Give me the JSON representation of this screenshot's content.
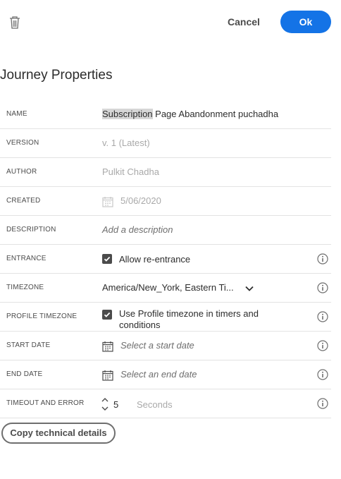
{
  "header": {
    "cancel_label": "Cancel",
    "ok_label": "Ok"
  },
  "page_title": "Journey Properties",
  "properties": {
    "name": {
      "label": "NAME",
      "value_highlight": "Subscription",
      "value_rest": " Page Abandonment puchadha"
    },
    "version": {
      "label": "VERSION",
      "value": "v. 1 (Latest)"
    },
    "author": {
      "label": "AUTHOR",
      "value": "Pulkit Chadha"
    },
    "created": {
      "label": "CREATED",
      "value": "5/06/2020"
    },
    "description": {
      "label": "DESCRIPTION",
      "placeholder": "Add a description"
    },
    "entrance": {
      "label": "ENTRANCE",
      "checkbox_label": "Allow re-entrance",
      "checked": true
    },
    "timezone": {
      "label": "TIMEZONE",
      "value": "America/New_York, Eastern Ti..."
    },
    "profile_timezone": {
      "label": "PROFILE TIMEZONE",
      "checkbox_label": "Use Profile timezone in timers and conditions",
      "checked": true
    },
    "start_date": {
      "label": "START DATE",
      "placeholder": "Select a start date"
    },
    "end_date": {
      "label": "END DATE",
      "placeholder": "Select an end date"
    },
    "timeout": {
      "label": "TIMEOUT AND ERROR",
      "value": "5",
      "unit": "Seconds"
    }
  },
  "copy_button_label": "Copy technical details",
  "colors": {
    "accent": "#1473e6",
    "text": "#2c2c2c",
    "muted": "#a9a9a9",
    "divider": "#e3e3e3"
  },
  "icons": [
    "trash-icon",
    "calendar-icon",
    "info-icon",
    "chevron-down-icon",
    "stepper-icon",
    "checkmark-icon"
  ]
}
